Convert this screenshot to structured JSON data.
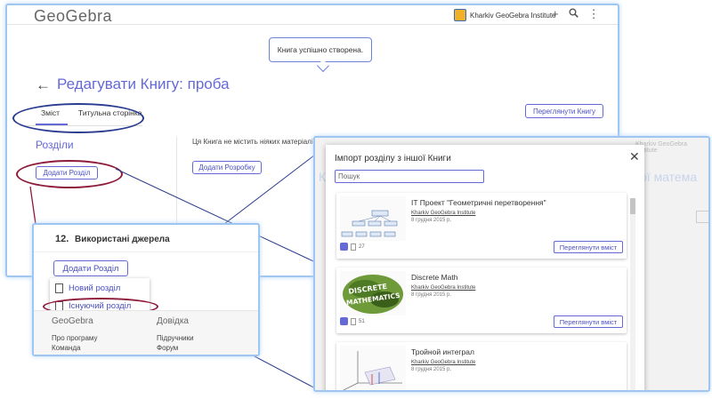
{
  "header": {
    "logo": "GeoGebra",
    "institution": "Kharkiv GeoGebra Institute",
    "icons": [
      "plus-icon",
      "search-icon",
      "more-vert-icon"
    ]
  },
  "toast": {
    "message": "Книга успішно створена."
  },
  "page": {
    "title": "Редагувати Книгу: проба",
    "tabs": [
      {
        "label": "Зміст",
        "active": true
      },
      {
        "label": "Титульна сторінка",
        "active": false
      }
    ],
    "view_book_label": "Переглянути Книгу",
    "sections_heading": "Розділи",
    "add_section_label": "Додати Розділ",
    "empty_message": "Ця Книга не містить ніяких матеріалів",
    "add_topic_label": "Додати Розробку"
  },
  "inset": {
    "section_number": "12.",
    "section_title": "Використані джерела",
    "add_section_label": "Додати Розділ",
    "menu": [
      {
        "label": "Новий розділ"
      },
      {
        "label": "Існуючий розділ"
      }
    ],
    "footer": {
      "col1_head": "GeoGebra",
      "col1_items": [
        "Про програму",
        "Команда"
      ],
      "col2_head": "Довідка",
      "col2_items": [
        "Підручники",
        "Форум"
      ]
    }
  },
  "modal": {
    "title": "Імпорт розділу з іншої Книги",
    "search_placeholder": "Пошук",
    "close_icon": "close-icon",
    "items": [
      {
        "title": "IT Проект \"Геометричні перетворення\"",
        "author": "Kharkiv GeoGebra Institute",
        "date": "8 грудня 2015 р.",
        "count": "27",
        "button": "Переглянути вміст"
      },
      {
        "title": "Discrete Math",
        "author": "Kharkiv GeoGebra Institute",
        "date": "8 грудня 2015 р.",
        "count": "51",
        "button": "Переглянути вміст"
      },
      {
        "title": "Тройной интеграл",
        "author": "Kharkiv GeoGebra Institute",
        "date": "8 грудня 2015 р.",
        "count": "",
        "button": ""
      }
    ],
    "background_heading_left": "Кі",
    "background_heading_right": "ої матема"
  },
  "colors": {
    "accent": "#6569d6",
    "highlight_ring": "#8e1b3a",
    "tab_ring": "#2a3c8f",
    "panel_border": "#9ec6f0"
  }
}
